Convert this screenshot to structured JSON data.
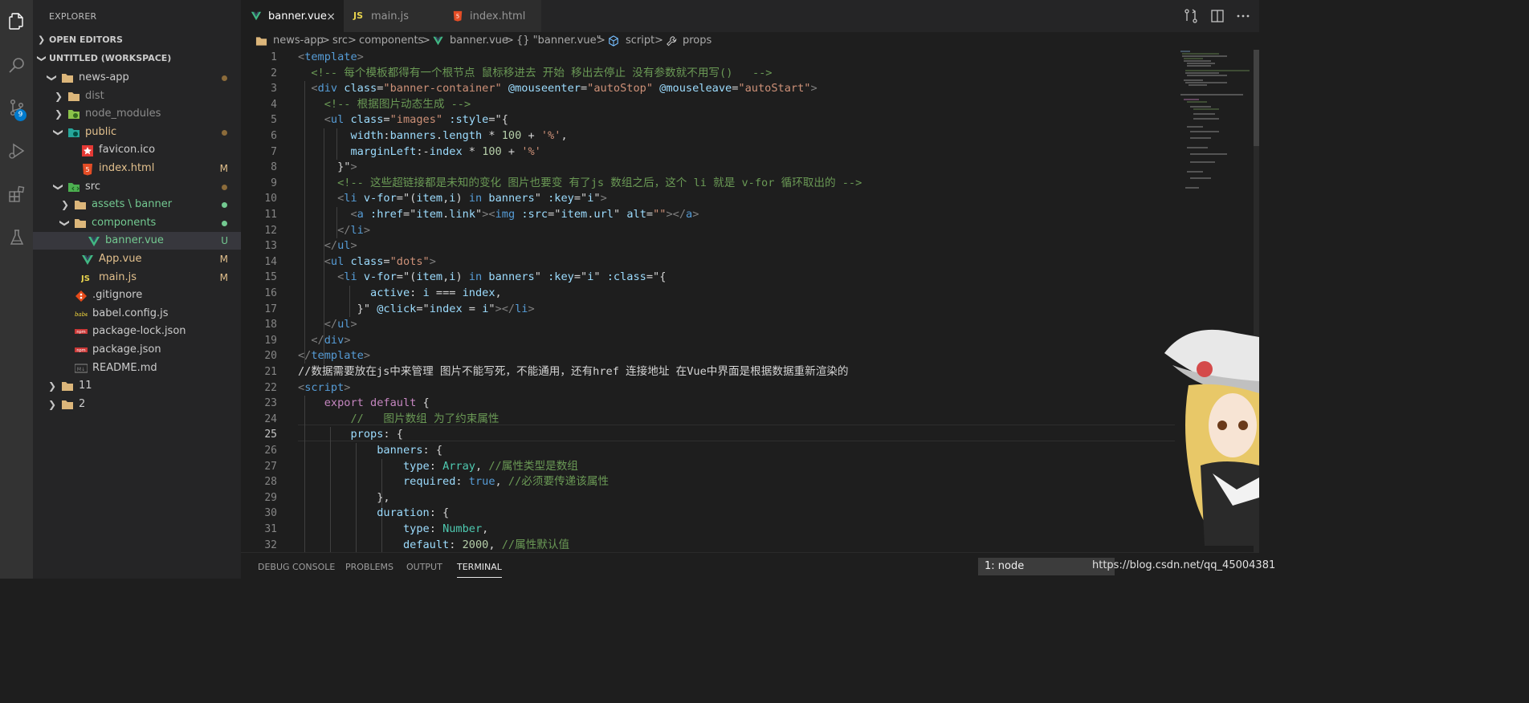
{
  "activity_bar": {
    "icons": [
      "files-icon",
      "search-icon",
      "source-control-icon",
      "run-debug-icon",
      "extensions-icon",
      "testing-icon"
    ],
    "scm_badge": "9"
  },
  "sidebar": {
    "title": "EXPLORER",
    "open_editors": "OPEN EDITORS",
    "workspace": "UNTITLED (WORKSPACE)",
    "tree": [
      {
        "label": "news-app",
        "type": "folder",
        "indent": 0,
        "expanded": true,
        "color": "#cccccc",
        "icon": "folder-icon"
      },
      {
        "label": "dist",
        "type": "folder",
        "indent": 1,
        "expanded": false,
        "color": "#8c8c8c",
        "icon": "folder-icon"
      },
      {
        "label": "node_modules",
        "type": "folder",
        "indent": 1,
        "expanded": false,
        "color": "#8c8c8c",
        "icon": "node-folder-icon"
      },
      {
        "label": "public",
        "type": "folder",
        "indent": 1,
        "expanded": true,
        "color": "#e2c08d",
        "icon": "public-folder-icon"
      },
      {
        "label": "favicon.ico",
        "type": "file",
        "indent": 2,
        "color": "#cccccc",
        "icon": "favicon-icon"
      },
      {
        "label": "index.html",
        "type": "file",
        "indent": 2,
        "color": "#e2c08d",
        "icon": "html-icon",
        "decoration": "M"
      },
      {
        "label": "src",
        "type": "folder",
        "indent": 1,
        "expanded": true,
        "color": "#cccccc",
        "icon": "src-folder-icon"
      },
      {
        "label": "assets \\ banner",
        "type": "folder",
        "indent": 2,
        "expanded": false,
        "color": "#73c991",
        "icon": "folder-icon"
      },
      {
        "label": "components",
        "type": "folder",
        "indent": 2,
        "expanded": true,
        "color": "#73c991",
        "icon": "folder-icon"
      },
      {
        "label": "banner.vue",
        "type": "file",
        "indent": 3,
        "color": "#73c991",
        "icon": "vue-icon",
        "decoration": "U",
        "selected": true
      },
      {
        "label": "App.vue",
        "type": "file",
        "indent": 2,
        "color": "#e2c08d",
        "icon": "vue-icon",
        "decoration": "M"
      },
      {
        "label": "main.js",
        "type": "file",
        "indent": 2,
        "color": "#e2c08d",
        "icon": "js-icon",
        "decoration": "M"
      },
      {
        "label": ".gitignore",
        "type": "file",
        "indent": 1,
        "color": "#cccccc",
        "icon": "git-icon"
      },
      {
        "label": "babel.config.js",
        "type": "file",
        "indent": 1,
        "color": "#cccccc",
        "icon": "babel-icon"
      },
      {
        "label": "package-lock.json",
        "type": "file",
        "indent": 1,
        "color": "#cccccc",
        "icon": "npm-icon"
      },
      {
        "label": "package.json",
        "type": "file",
        "indent": 1,
        "color": "#cccccc",
        "icon": "npm-icon"
      },
      {
        "label": "README.md",
        "type": "file",
        "indent": 1,
        "color": "#cccccc",
        "icon": "markdown-icon"
      },
      {
        "label": "11",
        "type": "folder",
        "indent": 0,
        "expanded": false,
        "color": "#cccccc",
        "icon": "folder-icon"
      },
      {
        "label": "2",
        "type": "folder",
        "indent": 0,
        "expanded": false,
        "color": "#cccccc",
        "icon": "folder-icon"
      }
    ]
  },
  "tabs": [
    {
      "label": "banner.vue",
      "icon": "vue-icon",
      "active": true,
      "close": "×"
    },
    {
      "label": "main.js",
      "icon": "js-icon",
      "active": false
    },
    {
      "label": "index.html",
      "icon": "html-icon",
      "active": false
    }
  ],
  "breadcrumb": [
    "news-app",
    ">",
    "src",
    ">",
    "components",
    ">",
    "banner.vue",
    ">",
    "{} \"banner.vue\"",
    ">",
    "script",
    ">",
    "props"
  ],
  "editor": {
    "lines": [
      [
        [
          "#808080",
          "<"
        ],
        [
          "#569cd6",
          "template"
        ],
        [
          "#808080",
          ">"
        ]
      ],
      [
        [
          "#6a9955",
          "  <!-- 每个模板都得有一个根节点 鼠标移进去 开始 移出去停止 没有参数就不用写()   -->"
        ]
      ],
      [
        [
          "#808080",
          "  <"
        ],
        [
          "#569cd6",
          "div"
        ],
        [
          "#9cdcfe",
          " class"
        ],
        [
          "#d4d4d4",
          "="
        ],
        [
          "#ce9178",
          "\"banner-container\""
        ],
        [
          "#9cdcfe",
          " @mouseenter"
        ],
        [
          "#d4d4d4",
          "="
        ],
        [
          "#ce9178",
          "\"autoStop\""
        ],
        [
          "#9cdcfe",
          " @mouseleave"
        ],
        [
          "#d4d4d4",
          "="
        ],
        [
          "#ce9178",
          "\"autoStart\""
        ],
        [
          "#808080",
          ">"
        ]
      ],
      [
        [
          "#6a9955",
          "    <!-- 根据图片动态生成 -->"
        ]
      ],
      [
        [
          "#808080",
          "    <"
        ],
        [
          "#569cd6",
          "ul"
        ],
        [
          "#9cdcfe",
          " class"
        ],
        [
          "#d4d4d4",
          "="
        ],
        [
          "#ce9178",
          "\"images\""
        ],
        [
          "#9cdcfe",
          " :style"
        ],
        [
          "#d4d4d4",
          "=\"{"
        ]
      ],
      [
        [
          "#9cdcfe",
          "        width"
        ],
        [
          "#d4d4d4",
          ":"
        ],
        [
          "#9cdcfe",
          "banners"
        ],
        [
          "#d4d4d4",
          "."
        ],
        [
          "#9cdcfe",
          "length"
        ],
        [
          "#d4d4d4",
          " * "
        ],
        [
          "#b5cea8",
          "100"
        ],
        [
          "#d4d4d4",
          " + "
        ],
        [
          "#ce9178",
          "'%'"
        ],
        [
          "#d4d4d4",
          ","
        ]
      ],
      [
        [
          "#9cdcfe",
          "        marginLeft"
        ],
        [
          "#d4d4d4",
          ":-"
        ],
        [
          "#9cdcfe",
          "index"
        ],
        [
          "#d4d4d4",
          " * "
        ],
        [
          "#b5cea8",
          "100"
        ],
        [
          "#d4d4d4",
          " + "
        ],
        [
          "#ce9178",
          "'%'"
        ]
      ],
      [
        [
          "#d4d4d4",
          "      }\""
        ],
        [
          "#808080",
          ">"
        ]
      ],
      [
        [
          "#6a9955",
          "      <!-- 这些超链接都是未知的变化 图片也要变 有了js 数组之后，这个 li 就是 v-for 循环取出的 -->"
        ]
      ],
      [
        [
          "#808080",
          "      <"
        ],
        [
          "#569cd6",
          "li"
        ],
        [
          "#9cdcfe",
          " v-for"
        ],
        [
          "#d4d4d4",
          "=\"("
        ],
        [
          "#9cdcfe",
          "item"
        ],
        [
          "#d4d4d4",
          ","
        ],
        [
          "#9cdcfe",
          "i"
        ],
        [
          "#d4d4d4",
          ") "
        ],
        [
          "#569cd6",
          "in"
        ],
        [
          "#9cdcfe",
          " banners"
        ],
        [
          "#d4d4d4",
          "\""
        ],
        [
          "#9cdcfe",
          " :key"
        ],
        [
          "#d4d4d4",
          "=\""
        ],
        [
          "#9cdcfe",
          "i"
        ],
        [
          "#d4d4d4",
          "\""
        ],
        [
          "#808080",
          ">"
        ]
      ],
      [
        [
          "#808080",
          "        <"
        ],
        [
          "#569cd6",
          "a"
        ],
        [
          "#9cdcfe",
          " :href"
        ],
        [
          "#d4d4d4",
          "=\""
        ],
        [
          "#9cdcfe",
          "item"
        ],
        [
          "#d4d4d4",
          "."
        ],
        [
          "#9cdcfe",
          "link"
        ],
        [
          "#d4d4d4",
          "\""
        ],
        [
          "#808080",
          "><"
        ],
        [
          "#569cd6",
          "img"
        ],
        [
          "#9cdcfe",
          " :src"
        ],
        [
          "#d4d4d4",
          "=\""
        ],
        [
          "#9cdcfe",
          "item"
        ],
        [
          "#d4d4d4",
          "."
        ],
        [
          "#9cdcfe",
          "url"
        ],
        [
          "#d4d4d4",
          "\""
        ],
        [
          "#9cdcfe",
          " alt"
        ],
        [
          "#d4d4d4",
          "="
        ],
        [
          "#ce9178",
          "\"\""
        ],
        [
          "#808080",
          "></"
        ],
        [
          "#569cd6",
          "a"
        ],
        [
          "#808080",
          ">"
        ]
      ],
      [
        [
          "#808080",
          "      </"
        ],
        [
          "#569cd6",
          "li"
        ],
        [
          "#808080",
          ">"
        ]
      ],
      [
        [
          "#808080",
          "    </"
        ],
        [
          "#569cd6",
          "ul"
        ],
        [
          "#808080",
          ">"
        ]
      ],
      [
        [
          "#808080",
          "    <"
        ],
        [
          "#569cd6",
          "ul"
        ],
        [
          "#9cdcfe",
          " class"
        ],
        [
          "#d4d4d4",
          "="
        ],
        [
          "#ce9178",
          "\"dots\""
        ],
        [
          "#808080",
          ">"
        ]
      ],
      [
        [
          "#808080",
          "      <"
        ],
        [
          "#569cd6",
          "li"
        ],
        [
          "#9cdcfe",
          " v-for"
        ],
        [
          "#d4d4d4",
          "=\"("
        ],
        [
          "#9cdcfe",
          "item"
        ],
        [
          "#d4d4d4",
          ","
        ],
        [
          "#9cdcfe",
          "i"
        ],
        [
          "#d4d4d4",
          ") "
        ],
        [
          "#569cd6",
          "in"
        ],
        [
          "#9cdcfe",
          " banners"
        ],
        [
          "#d4d4d4",
          "\""
        ],
        [
          "#9cdcfe",
          " :key"
        ],
        [
          "#d4d4d4",
          "=\""
        ],
        [
          "#9cdcfe",
          "i"
        ],
        [
          "#d4d4d4",
          "\""
        ],
        [
          "#9cdcfe",
          " :class"
        ],
        [
          "#d4d4d4",
          "=\"{"
        ]
      ],
      [
        [
          "#9cdcfe",
          "           active"
        ],
        [
          "#d4d4d4",
          ": "
        ],
        [
          "#9cdcfe",
          "i"
        ],
        [
          "#d4d4d4",
          " === "
        ],
        [
          "#9cdcfe",
          "index"
        ],
        [
          "#d4d4d4",
          ","
        ]
      ],
      [
        [
          "#d4d4d4",
          "         }\""
        ],
        [
          "#9cdcfe",
          " @click"
        ],
        [
          "#d4d4d4",
          "=\""
        ],
        [
          "#9cdcfe",
          "index"
        ],
        [
          "#d4d4d4",
          " = "
        ],
        [
          "#9cdcfe",
          "i"
        ],
        [
          "#d4d4d4",
          "\""
        ],
        [
          "#808080",
          "></"
        ],
        [
          "#569cd6",
          "li"
        ],
        [
          "#808080",
          ">"
        ]
      ],
      [
        [
          "#808080",
          "    </"
        ],
        [
          "#569cd6",
          "ul"
        ],
        [
          "#808080",
          ">"
        ]
      ],
      [
        [
          "#808080",
          "  </"
        ],
        [
          "#569cd6",
          "div"
        ],
        [
          "#808080",
          ">"
        ]
      ],
      [
        [
          "#808080",
          "</"
        ],
        [
          "#569cd6",
          "template"
        ],
        [
          "#808080",
          ">"
        ]
      ],
      [
        [
          "#d4d4d4",
          "//数据需要放在js中来管理 图片不能写死，不能通用，还有href 连接地址 在Vue中界面是根据数据重新渲染的"
        ]
      ],
      [
        [
          "#808080",
          "<"
        ],
        [
          "#569cd6",
          "script"
        ],
        [
          "#808080",
          ">"
        ]
      ],
      [
        [
          "#c586c0",
          "    export"
        ],
        [
          "#c586c0",
          " default"
        ],
        [
          "#d4d4d4",
          " {"
        ]
      ],
      [
        [
          "#6a9955",
          "        //   图片数组 为了约束属性"
        ]
      ],
      [
        [
          "#9cdcfe",
          "        props"
        ],
        [
          "#d4d4d4",
          ": {"
        ]
      ],
      [
        [
          "#9cdcfe",
          "            banners"
        ],
        [
          "#d4d4d4",
          ": {"
        ]
      ],
      [
        [
          "#9cdcfe",
          "                type"
        ],
        [
          "#d4d4d4",
          ": "
        ],
        [
          "#4ec9b0",
          "Array"
        ],
        [
          "#d4d4d4",
          ", "
        ],
        [
          "#6a9955",
          "//属性类型是数组"
        ]
      ],
      [
        [
          "#9cdcfe",
          "                required"
        ],
        [
          "#d4d4d4",
          ": "
        ],
        [
          "#569cd6",
          "true"
        ],
        [
          "#d4d4d4",
          ", "
        ],
        [
          "#6a9955",
          "//必须要传递该属性"
        ]
      ],
      [
        [
          "#d4d4d4",
          "            },"
        ]
      ],
      [
        [
          "#9cdcfe",
          "            duration"
        ],
        [
          "#d4d4d4",
          ": {"
        ]
      ],
      [
        [
          "#9cdcfe",
          "                type"
        ],
        [
          "#d4d4d4",
          ": "
        ],
        [
          "#4ec9b0",
          "Number"
        ],
        [
          "#d4d4d4",
          ","
        ]
      ],
      [
        [
          "#9cdcfe",
          "                default"
        ],
        [
          "#d4d4d4",
          ": "
        ],
        [
          "#b5cea8",
          "2000"
        ],
        [
          "#d4d4d4",
          ", "
        ],
        [
          "#6a9955",
          "//属性默认值"
        ]
      ]
    ],
    "line_numbers": [
      "1",
      "2",
      "3",
      "4",
      "5",
      "6",
      "7",
      "8",
      "9",
      "10",
      "11",
      "12",
      "13",
      "14",
      "15",
      "16",
      "17",
      "18",
      "19",
      "20",
      "21",
      "22",
      "23",
      "24",
      "25",
      "26",
      "27",
      "28",
      "29",
      "30",
      "31",
      "32"
    ]
  },
  "panel": {
    "tabs": [
      {
        "label": "DEBUG CONSOLE",
        "active": false
      },
      {
        "label": "PROBLEMS",
        "active": false
      },
      {
        "label": "OUTPUT",
        "active": false
      },
      {
        "label": "TERMINAL",
        "active": true
      }
    ],
    "terminal_select": "1: node"
  },
  "watermark": "https://blog.csdn.net/qq_45004381"
}
